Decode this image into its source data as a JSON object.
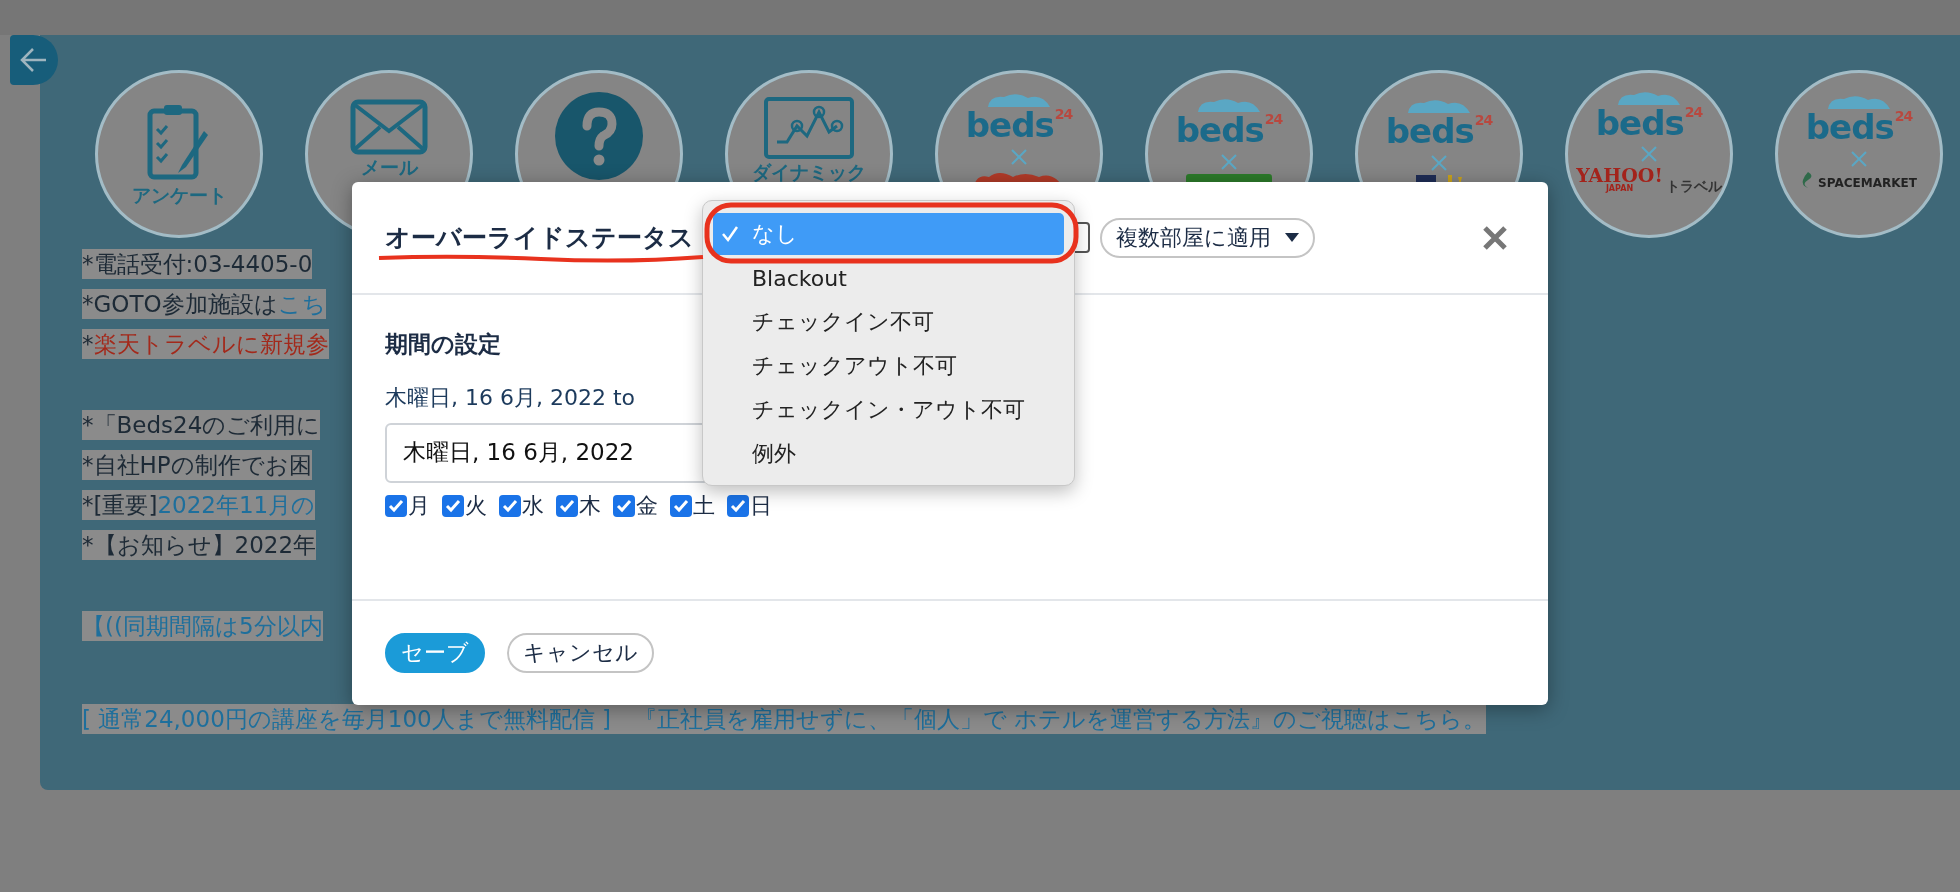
{
  "shortcuts": [
    {
      "kind": "survey",
      "label": "アンケート"
    },
    {
      "kind": "mail",
      "label": "メール"
    },
    {
      "kind": "help"
    },
    {
      "kind": "dynamic",
      "label": "ダイナミック"
    },
    {
      "kind": "beds-red",
      "logo": "beds",
      "logo_sup": "24"
    },
    {
      "kind": "beds-rakuten",
      "logo": "beds",
      "logo_sup": "24"
    },
    {
      "kind": "beds-block",
      "logo": "beds",
      "logo_sup": "24"
    },
    {
      "kind": "beds-yahoo",
      "logo": "beds",
      "logo_sup": "24",
      "partner": "YAHOO!",
      "partner_sub": "JAPAN",
      "partner_suffix": "トラベル"
    },
    {
      "kind": "beds-spacemarket",
      "logo": "beds",
      "logo_sup": "24",
      "partner": "SPACEMARKET"
    }
  ],
  "notice_groups": [
    [
      [
        {
          "kind": "text",
          "text": "*電話受付:03-4405-0"
        }
      ],
      [
        {
          "kind": "text",
          "text": "*GOTO参加施設は"
        },
        {
          "kind": "link",
          "text": "こち"
        }
      ],
      [
        {
          "kind": "text",
          "text": "*"
        },
        {
          "kind": "alert",
          "text": "楽天トラベルに新規参"
        }
      ]
    ],
    [
      [
        {
          "kind": "text",
          "text": "*「Beds24のご利用に"
        }
      ],
      [
        {
          "kind": "text",
          "text": "*自社HPの制作でお困"
        }
      ],
      [
        {
          "kind": "text",
          "text": "*[重要] "
        },
        {
          "kind": "link",
          "text": "2022年11月の"
        }
      ],
      [
        {
          "kind": "text",
          "text": "*【お知らせ】2022年"
        }
      ]
    ],
    [
      [
        {
          "kind": "link",
          "text": "【((同期間隔は5分以内"
        }
      ]
    ],
    [
      [
        {
          "kind": "link",
          "text": "[ 通常24,000円の講座を毎月100人まで無料配信 ]　『正社員を雇用せずに、「個人」で ホテルを運営する方法』のご視聴はこちら。"
        }
      ]
    ]
  ],
  "dialog": {
    "title": "オーバーライドステータス",
    "status_options": [
      {
        "label": "なし",
        "selected": true
      },
      {
        "label": "Blackout",
        "selected": false
      },
      {
        "label": "チェックイン不可",
        "selected": false
      },
      {
        "label": "チェックアウト不可",
        "selected": false
      },
      {
        "label": "チェックイン・アウト不可",
        "selected": false
      },
      {
        "label": "例外",
        "selected": false
      }
    ],
    "apply_menu": "複数部屋に適用",
    "section_title": "期間の設定",
    "date_range": "木曜日, 16 6月, 2022 to",
    "start_date": "木曜日, 16 6月, 2022",
    "weekdays": [
      {
        "label": "月",
        "checked": true
      },
      {
        "label": "火",
        "checked": true
      },
      {
        "label": "水",
        "checked": true
      },
      {
        "label": "木",
        "checked": true
      },
      {
        "label": "金",
        "checked": true
      },
      {
        "label": "土",
        "checked": true
      },
      {
        "label": "日",
        "checked": true
      }
    ],
    "buttons": [
      {
        "label": "セーブ",
        "kind": "primary"
      },
      {
        "label": "キャンセル",
        "kind": "secondary"
      }
    ]
  }
}
